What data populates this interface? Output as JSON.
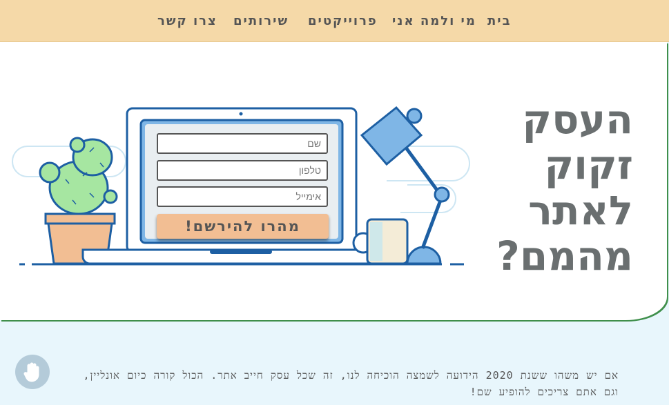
{
  "nav": {
    "items": [
      "בית",
      "מי ולמה אני",
      "פרוייקטים",
      "שירותים",
      "צרו קשר"
    ]
  },
  "hero": {
    "title_lines": [
      "העסק",
      "זקוק",
      "לאתר",
      "מהמם?"
    ]
  },
  "form": {
    "name_placeholder": "שם",
    "phone_placeholder": "טלפון",
    "email_placeholder": "אימייל",
    "submit_label": "מהרו להירשם!"
  },
  "content": {
    "paragraph": "אם יש משהו ששנת 2020 הידועה לשמצה הוכיחה לנו, זה שכל עסק חייב אתר. הכול קורה כיום אונליין, וגם אתם צריכים להופיע שם!"
  },
  "icons": {
    "accessibility": "hand-icon"
  },
  "colors": {
    "nav_bg": "#f5d9a8",
    "cta_bg": "#f2be93",
    "page_bg": "#e8f6fc",
    "title": "#6a6f70"
  }
}
